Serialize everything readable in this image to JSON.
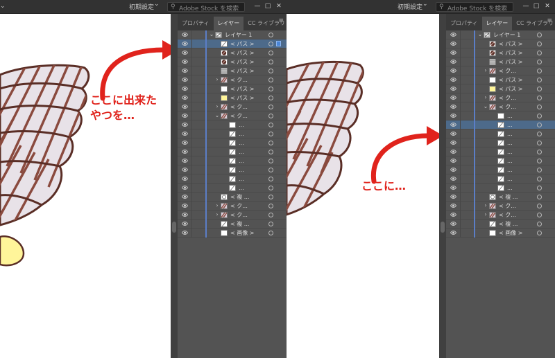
{
  "left": {
    "preset": "初期設定",
    "stock_placeholder": "Adobe Stock を検索",
    "tabs": [
      {
        "label": "プロパティ",
        "active": false
      },
      {
        "label": "レイヤー",
        "active": true
      },
      {
        "label": "ライブラリ",
        "active": false
      }
    ],
    "annotation": [
      "ここに出来た",
      "やつを…"
    ],
    "layers": [
      {
        "name": "レイヤー 1",
        "indent": 0,
        "twirl": "v",
        "thumb": "layer",
        "selected": false,
        "mark": false
      },
      {
        "name": "< パス >",
        "indent": 2,
        "twirl": "",
        "thumb": "line",
        "selected": true,
        "mark": true
      },
      {
        "name": "< パス >",
        "indent": 2,
        "twirl": "",
        "thumb": "circle",
        "selected": false,
        "mark": false
      },
      {
        "name": "< パス >",
        "indent": 2,
        "twirl": "",
        "thumb": "circle",
        "selected": false,
        "mark": false
      },
      {
        "name": "< パス >",
        "indent": 2,
        "twirl": "",
        "thumb": "lines",
        "selected": false,
        "mark": false
      },
      {
        "name": "< ク...",
        "indent": 2,
        "twirl": ">",
        "thumb": "stripe",
        "selected": false,
        "mark": false
      },
      {
        "name": "< パス >",
        "indent": 2,
        "twirl": "",
        "thumb": "blank",
        "selected": false,
        "mark": false
      },
      {
        "name": "< パス >",
        "indent": 2,
        "twirl": "",
        "thumb": "yellow",
        "selected": false,
        "mark": false
      },
      {
        "name": "< ク...",
        "indent": 2,
        "twirl": ">",
        "thumb": "stripe",
        "selected": false,
        "mark": false
      },
      {
        "name": "< ク...",
        "indent": 2,
        "twirl": "v",
        "thumb": "stripe",
        "selected": false,
        "mark": false
      },
      {
        "name": "...",
        "indent": 3,
        "twirl": "",
        "thumb": "blank",
        "selected": false,
        "mark": false
      },
      {
        "name": "...",
        "indent": 3,
        "twirl": "",
        "thumb": "line",
        "selected": false,
        "mark": false
      },
      {
        "name": "...",
        "indent": 3,
        "twirl": "",
        "thumb": "line",
        "selected": false,
        "mark": false
      },
      {
        "name": "...",
        "indent": 3,
        "twirl": "",
        "thumb": "line",
        "selected": false,
        "mark": false
      },
      {
        "name": "...",
        "indent": 3,
        "twirl": "",
        "thumb": "line",
        "selected": false,
        "mark": false
      },
      {
        "name": "...",
        "indent": 3,
        "twirl": "",
        "thumb": "line",
        "selected": false,
        "mark": false
      },
      {
        "name": "...",
        "indent": 3,
        "twirl": "",
        "thumb": "line",
        "selected": false,
        "mark": false
      },
      {
        "name": "...",
        "indent": 3,
        "twirl": "",
        "thumb": "line",
        "selected": false,
        "mark": false
      },
      {
        "name": "< 複 ...",
        "indent": 2,
        "twirl": "",
        "thumb": "copy",
        "selected": false,
        "mark": false
      },
      {
        "name": "< ク...",
        "indent": 2,
        "twirl": ">",
        "thumb": "stripe",
        "selected": false,
        "mark": false
      },
      {
        "name": "< ク...",
        "indent": 2,
        "twirl": ">",
        "thumb": "stripe",
        "selected": false,
        "mark": false
      },
      {
        "name": "< 複 ...",
        "indent": 2,
        "twirl": "",
        "thumb": "line",
        "selected": false,
        "mark": false
      },
      {
        "name": "< 画像 >",
        "indent": 2,
        "twirl": "",
        "thumb": "blank",
        "selected": false,
        "mark": false
      }
    ]
  },
  "right": {
    "preset": "初期設定",
    "stock_placeholder": "Adobe Stock を検索",
    "tabs": [
      {
        "label": "プロパティ",
        "active": false
      },
      {
        "label": "レイヤー",
        "active": true
      },
      {
        "label": "ライブラリ",
        "active": false
      }
    ],
    "annotation": [
      "ここに…"
    ],
    "layers": [
      {
        "name": "レイヤー 1",
        "indent": 0,
        "twirl": "v",
        "thumb": "layer",
        "selected": false,
        "mark": false
      },
      {
        "name": "< パス >",
        "indent": 2,
        "twirl": "",
        "thumb": "circle",
        "selected": false,
        "mark": false
      },
      {
        "name": "< パス >",
        "indent": 2,
        "twirl": "",
        "thumb": "circle",
        "selected": false,
        "mark": false
      },
      {
        "name": "< パス >",
        "indent": 2,
        "twirl": "",
        "thumb": "lines",
        "selected": false,
        "mark": false
      },
      {
        "name": "< ク...",
        "indent": 2,
        "twirl": ">",
        "thumb": "stripe",
        "selected": false,
        "mark": false
      },
      {
        "name": "< パス >",
        "indent": 2,
        "twirl": "",
        "thumb": "blank",
        "selected": false,
        "mark": false
      },
      {
        "name": "< パス >",
        "indent": 2,
        "twirl": "",
        "thumb": "yellow",
        "selected": false,
        "mark": false
      },
      {
        "name": "< ク...",
        "indent": 2,
        "twirl": ">",
        "thumb": "stripe",
        "selected": false,
        "mark": false
      },
      {
        "name": "< ク...",
        "indent": 2,
        "twirl": "v",
        "thumb": "stripe",
        "selected": false,
        "mark": false
      },
      {
        "name": "...",
        "indent": 3,
        "twirl": "",
        "thumb": "blank",
        "selected": false,
        "mark": false
      },
      {
        "name": "...",
        "indent": 3,
        "twirl": "",
        "thumb": "line",
        "selected": true,
        "mark": false
      },
      {
        "name": "...",
        "indent": 3,
        "twirl": "",
        "thumb": "line",
        "selected": false,
        "mark": false
      },
      {
        "name": "...",
        "indent": 3,
        "twirl": "",
        "thumb": "line",
        "selected": false,
        "mark": false
      },
      {
        "name": "...",
        "indent": 3,
        "twirl": "",
        "thumb": "line",
        "selected": false,
        "mark": false
      },
      {
        "name": "...",
        "indent": 3,
        "twirl": "",
        "thumb": "line",
        "selected": false,
        "mark": false
      },
      {
        "name": "...",
        "indent": 3,
        "twirl": "",
        "thumb": "line",
        "selected": false,
        "mark": false
      },
      {
        "name": "...",
        "indent": 3,
        "twirl": "",
        "thumb": "line",
        "selected": false,
        "mark": false
      },
      {
        "name": "...",
        "indent": 3,
        "twirl": "",
        "thumb": "line",
        "selected": false,
        "mark": false
      },
      {
        "name": "< 複 ...",
        "indent": 2,
        "twirl": "",
        "thumb": "copy",
        "selected": false,
        "mark": false
      },
      {
        "name": "< ク...",
        "indent": 2,
        "twirl": ">",
        "thumb": "stripe",
        "selected": false,
        "mark": false
      },
      {
        "name": "< ク...",
        "indent": 2,
        "twirl": ">",
        "thumb": "stripe",
        "selected": false,
        "mark": false
      },
      {
        "name": "< 複 ...",
        "indent": 2,
        "twirl": "",
        "thumb": "line",
        "selected": false,
        "mark": false
      },
      {
        "name": "< 画像 >",
        "indent": 2,
        "twirl": "",
        "thumb": "blank",
        "selected": false,
        "mark": false
      }
    ]
  },
  "colors": {
    "annotation": "#e0231c",
    "selection": "#4d6a8a",
    "layer_bar": "#5b7ec7",
    "shell_fill": "#e8e2e8",
    "shell_stroke": "#5a2e26",
    "shell_stripe": "#8a4a3e",
    "yellow": "#fff59a"
  },
  "icons": {
    "eye": "eye-icon",
    "search": "search-icon",
    "menu": "panel-menu-icon",
    "chevron": "chevron-down-icon",
    "minimize": "minimize-icon",
    "maximize": "maximize-icon",
    "close": "close-icon",
    "target": "target-icon"
  }
}
